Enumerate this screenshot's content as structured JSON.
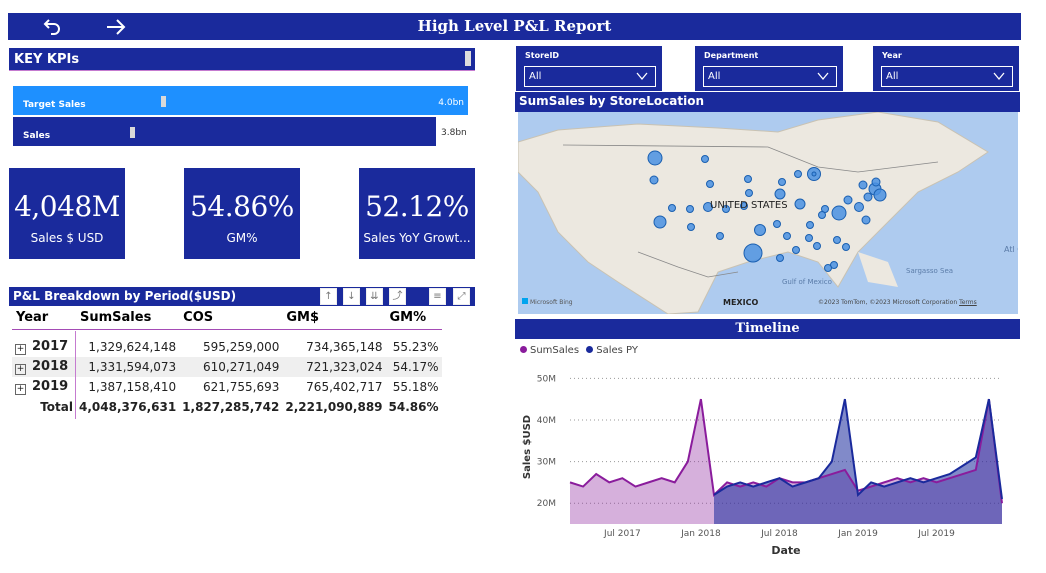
{
  "title": "High Level P&L Report",
  "nav": {
    "back_icon": "undo-arrow-icon",
    "forward_icon": "right-arrow-icon"
  },
  "kpis": {
    "header": "KEY KPIs",
    "bars": [
      {
        "label": "Target Sales",
        "value_label": "4.0bn",
        "value": 4.0
      },
      {
        "label": "Sales",
        "value_label": "3.8bn",
        "value": 3.8
      }
    ],
    "cards": [
      {
        "value": "4,048M",
        "label": "Sales $ USD"
      },
      {
        "value": "54.86%",
        "label": "GM%"
      },
      {
        "value": "52.12%",
        "label": "Sales YoY Growt..."
      }
    ]
  },
  "pl": {
    "header": "P&L Breakdown by Period($USD)",
    "columns": [
      "Year",
      "SumSales",
      "COS",
      "GM$",
      "GM%"
    ],
    "rows": [
      {
        "year": "2017",
        "sales": "1,329,624,148",
        "cos": "595,259,000",
        "gm": "734,365,148",
        "gmp": "55.23%"
      },
      {
        "year": "2018",
        "sales": "1,331,594,073",
        "cos": "610,271,049",
        "gm": "721,323,024",
        "gmp": "54.17%"
      },
      {
        "year": "2019",
        "sales": "1,387,158,410",
        "cos": "621,755,693",
        "gm": "765,402,717",
        "gmp": "55.18%"
      }
    ],
    "total": {
      "label": "Total",
      "sales": "4,048,376,631",
      "cos": "1,827,285,742",
      "gm": "2,221,090,889",
      "gmp": "54.86%"
    }
  },
  "slicers": [
    {
      "label": "StoreID",
      "value": "All"
    },
    {
      "label": "Department",
      "value": "All"
    },
    {
      "label": "Year",
      "value": "All"
    }
  ],
  "map": {
    "header": "SumSales by StoreLocation",
    "labels": {
      "us": "UNITED STATES",
      "mexico": "MEXICO",
      "gulf": "Gulf of Mexico",
      "sargasso": "Sargasso Sea",
      "atl": "Atl O"
    },
    "bing": "Microsoft Bing",
    "copyright": "©2023 TomTom, ©2023 Microsoft Corporation",
    "terms": "Terms"
  },
  "timeline": {
    "header": "Timeline",
    "legend": [
      {
        "name": "SumSales",
        "color": "#8a1c9c"
      },
      {
        "name": "Sales PY",
        "color": "#1a2a9c"
      }
    ]
  },
  "chart_data": {
    "type": "area",
    "xlabel": "Date",
    "ylabel": "Sales $USD",
    "x_ticks": [
      "Jul 2017",
      "Jan 2018",
      "Jul 2018",
      "Jan 2019",
      "Jul 2019"
    ],
    "y_ticks": [
      "20M",
      "30M",
      "40M",
      "50M"
    ],
    "ylim": [
      15,
      52
    ],
    "x": [
      "2017-03",
      "2017-04",
      "2017-05",
      "2017-06",
      "2017-07",
      "2017-08",
      "2017-09",
      "2017-10",
      "2017-11",
      "2017-12",
      "2018-01",
      "2018-02",
      "2018-03",
      "2018-04",
      "2018-05",
      "2018-06",
      "2018-07",
      "2018-08",
      "2018-09",
      "2018-10",
      "2018-11",
      "2018-12",
      "2019-01",
      "2019-02",
      "2019-03",
      "2019-04",
      "2019-05",
      "2019-06",
      "2019-07",
      "2019-08",
      "2019-09",
      "2019-10",
      "2019-11",
      "2019-12"
    ],
    "series": [
      {
        "name": "SumSales",
        "color": "#8a1c9c",
        "values": [
          25,
          24,
          27,
          25,
          26,
          24,
          25,
          26,
          25,
          30,
          45,
          22,
          25,
          24,
          25,
          24,
          26,
          25,
          25,
          26,
          27,
          28,
          23,
          24,
          25,
          26,
          25,
          26,
          25,
          26,
          27,
          28,
          45,
          20
        ]
      },
      {
        "name": "Sales PY",
        "color": "#1a2a9c",
        "values": [
          null,
          null,
          null,
          null,
          null,
          null,
          null,
          null,
          null,
          null,
          null,
          22,
          24,
          25,
          24,
          25,
          26,
          24,
          25,
          26,
          30,
          45,
          22,
          25,
          24,
          25,
          26,
          25,
          26,
          27,
          29,
          31,
          45,
          21
        ]
      }
    ]
  }
}
